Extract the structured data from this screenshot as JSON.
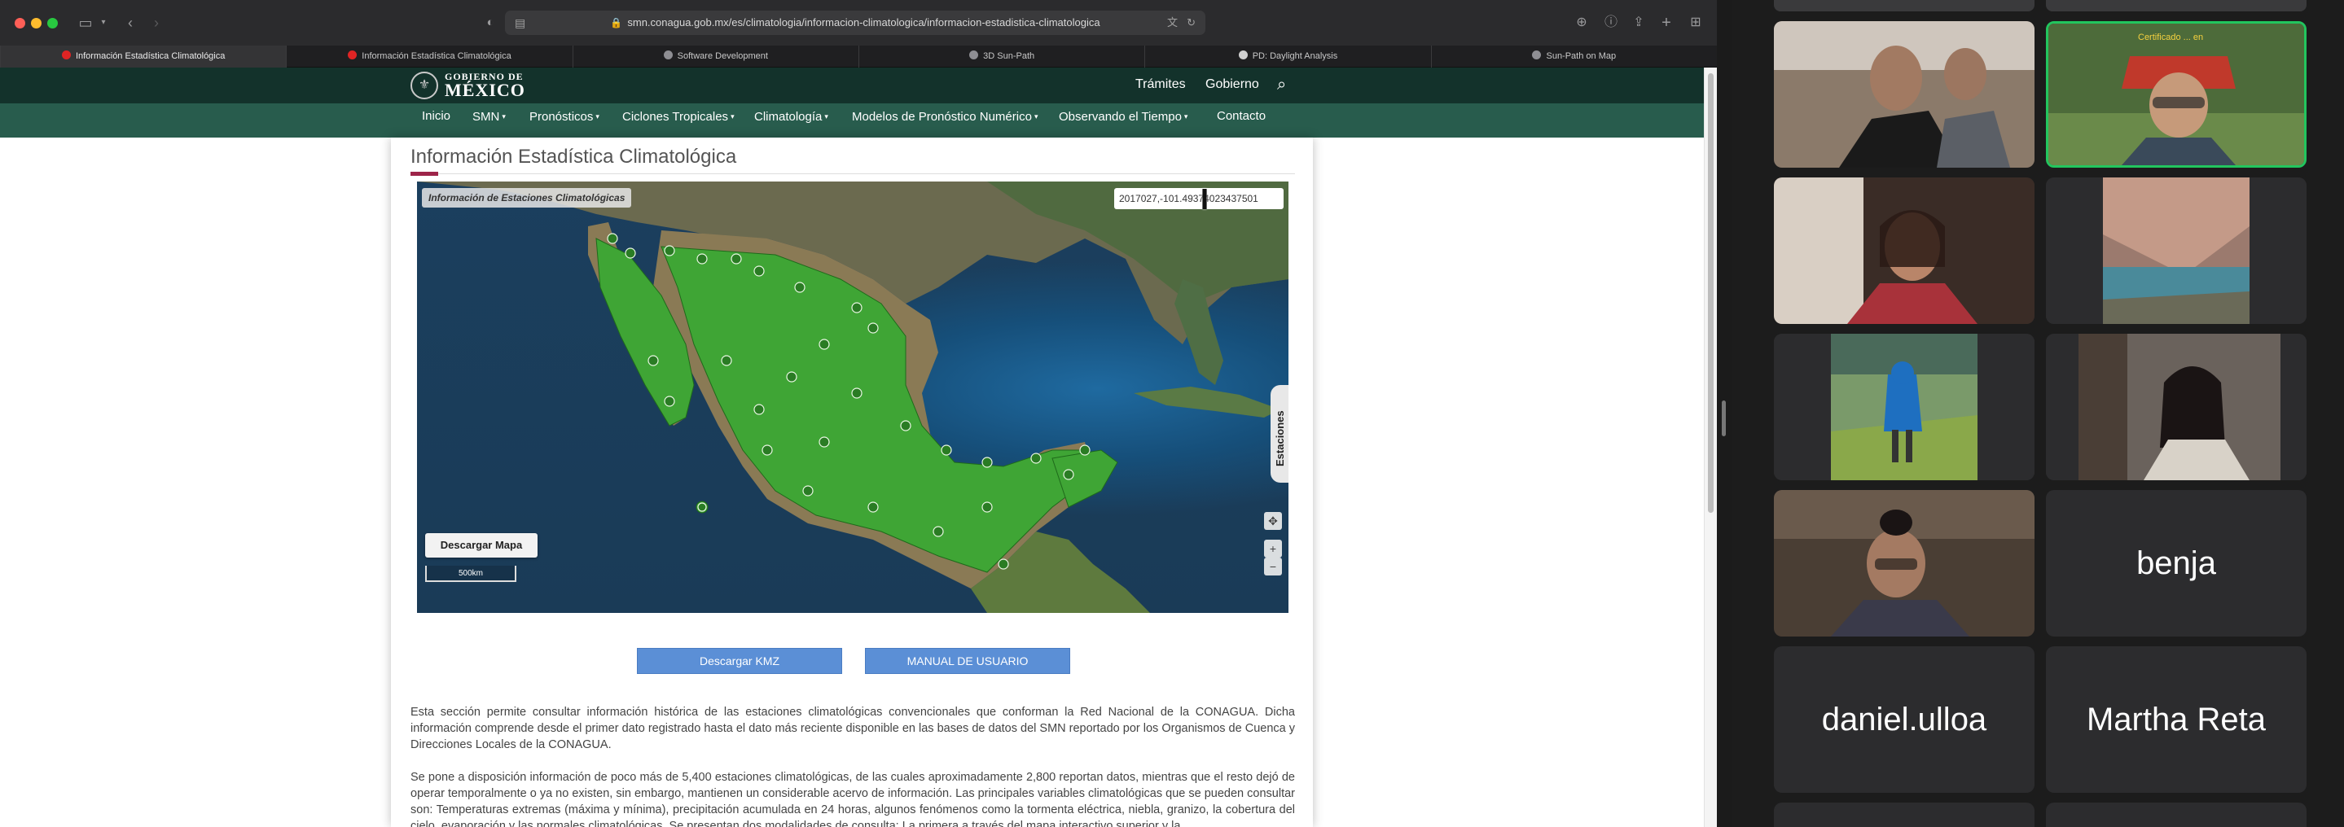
{
  "browser": {
    "url": "smn.conagua.gob.mx/es/climatologia/informacion-climatologica/informacion-estadistica-climatologica",
    "tabs": [
      {
        "label": "Información Estadística Climatológica",
        "active": true,
        "favicon_color": "#e02424"
      },
      {
        "label": "Información Estadística Climatológica",
        "active": false,
        "favicon_color": "#e02424"
      },
      {
        "label": "Software Development",
        "active": false,
        "favicon_color": "#8e8e93"
      },
      {
        "label": "3D Sun-Path",
        "active": false,
        "favicon_color": "#8e8e93"
      },
      {
        "label": "PD: Daylight Analysis",
        "active": false,
        "favicon_color": "#d0d0d0"
      },
      {
        "label": "Sun-Path on Map",
        "active": false,
        "favicon_color": "#8e8e93"
      }
    ]
  },
  "gob_header": {
    "logo_line1": "GOBIERNO DE",
    "logo_line2": "MÉXICO",
    "links": [
      "Trámites",
      "Gobierno"
    ]
  },
  "nav": {
    "items": [
      {
        "label": "Inicio",
        "dropdown": false
      },
      {
        "label": "SMN",
        "dropdown": true
      },
      {
        "label": "Pronósticos",
        "dropdown": true
      },
      {
        "label": "Ciclones Tropicales",
        "dropdown": true
      },
      {
        "label": "Climatología",
        "dropdown": true
      },
      {
        "label": "Modelos de Pronóstico Numérico",
        "dropdown": true
      },
      {
        "label": "Observando el Tiempo",
        "dropdown": true
      },
      {
        "label": "Contacto",
        "dropdown": false
      }
    ]
  },
  "page": {
    "title": "Información Estadística Climatológica",
    "map": {
      "info_label": "Información de Estaciones Climatológicas",
      "coords_text": "2017027,-101.49374023437501",
      "stations_tab": "Estaciones",
      "download_map": "Descargar Mapa",
      "scale_label": "500km"
    },
    "buttons": {
      "kmz": "Descargar KMZ",
      "manual": "MANUAL DE USUARIO"
    },
    "paragraphs": [
      "Esta sección permite consultar información histórica de las estaciones climatológicas convencionales que conforman la Red Nacional de la CONAGUA. Dicha información comprende desde el primer dato registrado hasta el dato más reciente disponible en las bases de datos del SMN reportado por los Organismos de Cuenca y Direcciones Locales de la CONAGUA.",
      "Se pone a disposición información de poco más de 5,400 estaciones climatológicas, de las cuales aproximadamente 2,800 reportan datos, mientras que el resto dejó de operar temporalmente o ya no existen, sin embargo, mantienen un considerable acervo de información. Las principales variables climatológicas que se pueden consultar son: Temperaturas extremas (máxima y mínima), precipitación acumulada en 24 horas, algunos fenómenos como la tormenta eléctrica, niebla, granizo, la cobertura del cielo, evaporación y las normales climatológicas. Se presentan dos modalidades de consulta: La primera a través del mapa interactivo superior y la"
    ]
  },
  "meeting": {
    "participants": [
      {
        "name": "",
        "has_video": true,
        "speaking": false
      },
      {
        "name": "",
        "has_video": true,
        "speaking": true
      },
      {
        "name": "",
        "has_video": true,
        "speaking": false
      },
      {
        "name": "",
        "has_video": true,
        "speaking": false
      },
      {
        "name": "",
        "has_video": true,
        "speaking": false
      },
      {
        "name": "",
        "has_video": true,
        "speaking": false
      },
      {
        "name": "",
        "has_video": true,
        "speaking": false
      },
      {
        "name": "benja",
        "has_video": false,
        "speaking": false
      },
      {
        "name": "daniel.ulloa",
        "has_video": false,
        "speaking": false
      },
      {
        "name": "Martha Reta",
        "has_video": false,
        "speaking": false
      }
    ],
    "banner_text": "Certificado ... en"
  },
  "colors": {
    "gob_dark": "#13322b",
    "gob_nav": "#285c4d",
    "accent_red": "#9d2449",
    "button_blue": "#5b8fd6",
    "station_green": "#3fa535",
    "speaker_border": "#22c55e"
  }
}
